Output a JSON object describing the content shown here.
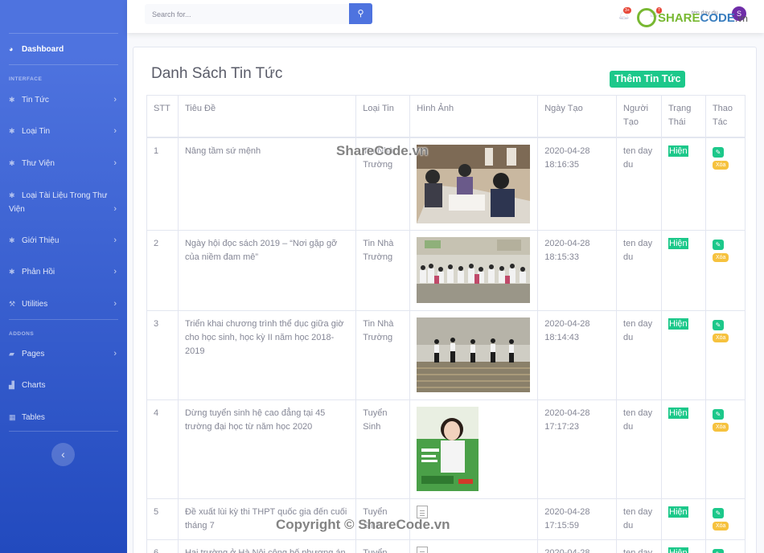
{
  "sidebar": {
    "dashboard": "Dashboard",
    "heading_interface": "INTERFACE",
    "heading_addons": "ADDONS",
    "items": [
      {
        "label": "Tin Tức",
        "icon": "gear-icon"
      },
      {
        "label": "Loại Tin",
        "icon": "gear-icon"
      },
      {
        "label": "Thư Viện",
        "icon": "gear-icon"
      },
      {
        "label": "Loại Tài Liệu Trong Thư Viện",
        "icon": "gear-icon"
      },
      {
        "label": "Giới Thiệu",
        "icon": "gear-icon"
      },
      {
        "label": "Phản Hồi",
        "icon": "gear-icon"
      },
      {
        "label": "Utilities",
        "icon": "wrench-icon"
      }
    ],
    "addons": [
      {
        "label": "Pages",
        "icon": "folder-icon"
      },
      {
        "label": "Charts",
        "icon": "chart-icon"
      },
      {
        "label": "Tables",
        "icon": "table-icon"
      }
    ],
    "toggle": "‹"
  },
  "topbar": {
    "search_placeholder": "Search for...",
    "alerts_count": "3+",
    "messages_count": "7",
    "user_name": "ten day du",
    "avatar_initial": "S"
  },
  "watermark": {
    "logo_part1": "SHARE",
    "logo_part2": "CODE",
    "logo_part3": ".vn",
    "center_text": "ShareCode.vn",
    "bottom_text": "Copyright © ShareCode.vn"
  },
  "main": {
    "title": "Danh Sách Tin Tức",
    "add_button": "Thêm Tin Tức",
    "columns": [
      "STT",
      "Tiêu Đề",
      "Loại Tin",
      "Hình Ảnh",
      "Ngày Tạo",
      "Người Tạo",
      "Trạng Thái",
      "Thao Tác"
    ],
    "status_label": "Hiện",
    "delete_label": "Xóa",
    "rows": [
      {
        "stt": "1",
        "title": "Nâng tầm sứ mệnh",
        "type": "Tin Nhà Trường",
        "date": "2020-04-28 18:16:35",
        "user": "ten day du",
        "image": "classroom"
      },
      {
        "stt": "2",
        "title": "Ngày hội đọc sách 2019 – “Nơi gặp gỡ của niềm đam mê”",
        "type": "Tin Nhà Trường",
        "date": "2020-04-28 18:15:33",
        "user": "ten day du",
        "image": "crowd"
      },
      {
        "stt": "3",
        "title": "Triển khai chương trình thể dục giữa giờ cho học sinh, học kỳ II năm học 2018-2019",
        "type": "Tin Nhà Trường",
        "date": "2020-04-28 18:14:43",
        "user": "ten day du",
        "image": "stage"
      },
      {
        "stt": "4",
        "title": "Dừng tuyển sinh hệ cao đẳng tại 45 trường đại học từ năm học 2020",
        "type": "Tuyển Sinh",
        "date": "2020-04-28 17:17:23",
        "user": "ten day du",
        "image": "poster"
      },
      {
        "stt": "5",
        "title": "Đề xuất lùi kỳ thi THPT quốc gia đến cuối tháng 7",
        "type": "Tuyển Sinh",
        "date": "2020-04-28 17:15:59",
        "user": "ten day du",
        "image": "broken"
      },
      {
        "stt": "6",
        "title": "Hai trường ở Hà Nội công bố phương án",
        "type": "Tuyển",
        "date": "2020-04-28",
        "user": "ten day",
        "image": "broken"
      }
    ]
  },
  "colors": {
    "primary": "#4e73df",
    "success": "#1cc88a",
    "warning": "#f6c23e"
  }
}
